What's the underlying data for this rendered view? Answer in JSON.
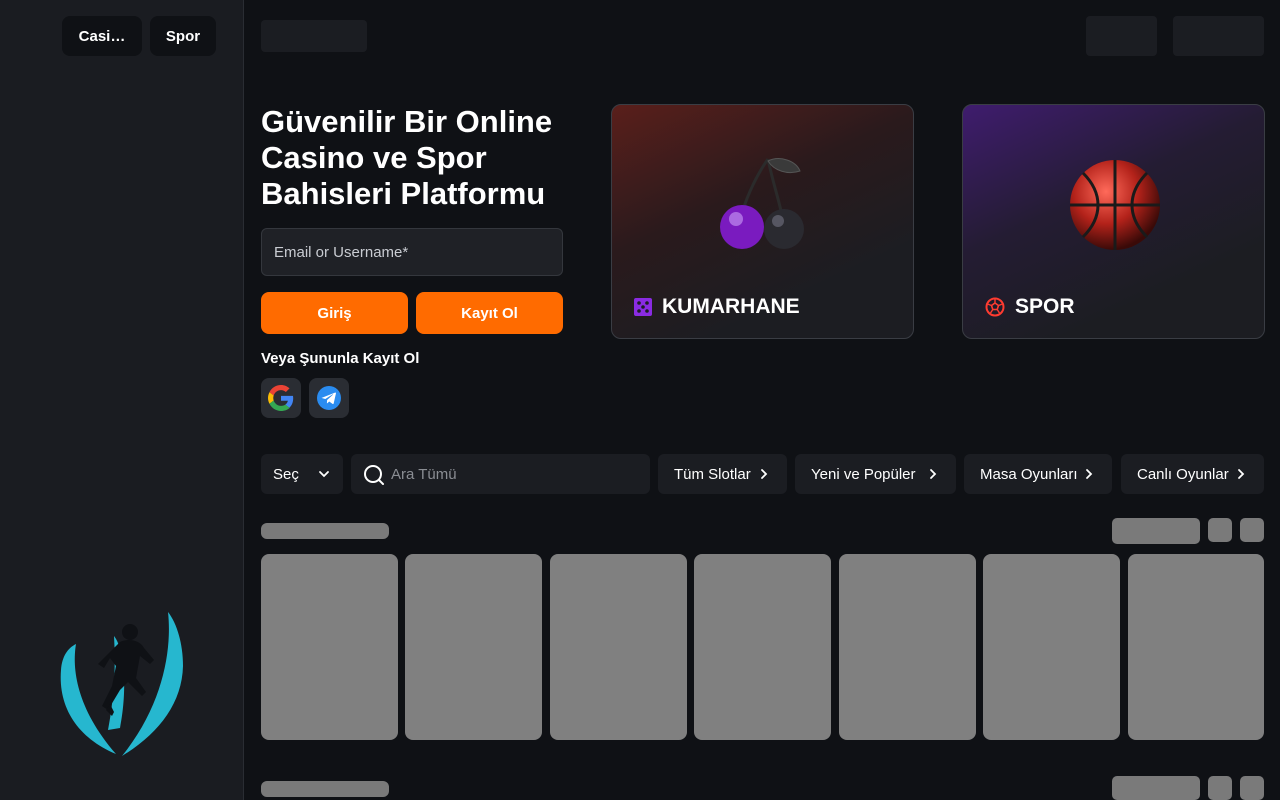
{
  "sidebar": {
    "tabs": [
      {
        "label": "Casi…"
      },
      {
        "label": "Spor"
      }
    ],
    "logo_icon": "player-shield-logo",
    "logo_color": "#26b7cf"
  },
  "hero": {
    "title": "Güvenilir Bir Online Casino ve Spor Bahisleri Platformu",
    "login_placeholder": "Email or Username*",
    "login_button": "Giriş",
    "register_button": "Kayıt Ol",
    "alt_signup_label": "Veya Şununla Kayıt Ol",
    "social_icons": [
      "google-icon",
      "telegram-icon"
    ]
  },
  "categories": [
    {
      "label": "KUMARHANE",
      "icon": "dice-icon",
      "art": "cherry-icon",
      "accent": "#8a2be2"
    },
    {
      "label": "SPOR",
      "icon": "soccer-ball-icon",
      "art": "basketball-icon",
      "accent": "#ff3b30"
    }
  ],
  "filters": {
    "select_label": "Seç",
    "search_placeholder": "Ara Tümü",
    "chips": [
      {
        "label": "Tüm Slotlar"
      },
      {
        "label": "Yeni ve Popüler"
      },
      {
        "label": "Masa Oyunları"
      },
      {
        "label": "Canlı Oyunlar"
      }
    ]
  },
  "colors": {
    "accent": "#ff6b00",
    "background": "#0f1115",
    "sidebar": "#1a1c21",
    "placeholder_skeleton": "#808080"
  }
}
